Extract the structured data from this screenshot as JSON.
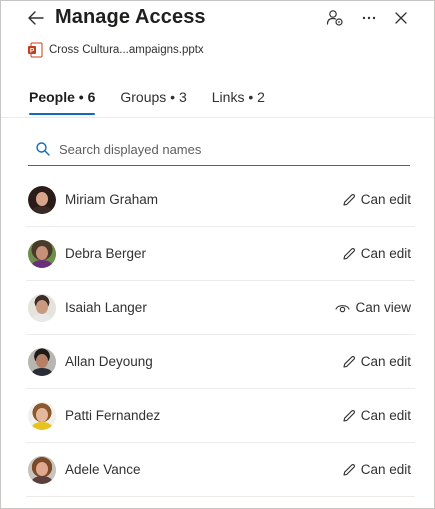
{
  "header": {
    "title": "Manage Access",
    "back_icon": "arrow-left-icon",
    "manage_icon": "people-settings-icon",
    "more_icon": "more-horizontal-icon",
    "close_icon": "close-icon"
  },
  "file": {
    "name": "Cross Cultura...ampaigns.pptx",
    "icon": "powerpoint-file-icon",
    "icon_color": "#c43e1c"
  },
  "tabs": [
    {
      "label": "People • 6",
      "active": true
    },
    {
      "label": "Groups • 3",
      "active": false
    },
    {
      "label": "Links • 2",
      "active": false
    }
  ],
  "search": {
    "placeholder": "Search displayed names",
    "value": ""
  },
  "people": [
    {
      "name": "Miriam Graham",
      "permission": "Can edit",
      "perm_icon": "pencil-icon"
    },
    {
      "name": "Debra Berger",
      "permission": "Can edit",
      "perm_icon": "pencil-icon"
    },
    {
      "name": "Isaiah Langer",
      "permission": "Can view",
      "perm_icon": "eye-icon"
    },
    {
      "name": "Allan Deyoung",
      "permission": "Can edit",
      "perm_icon": "pencil-icon"
    },
    {
      "name": "Patti Fernandez",
      "permission": "Can edit",
      "perm_icon": "pencil-icon"
    },
    {
      "name": "Adele Vance",
      "permission": "Can edit",
      "perm_icon": "pencil-icon"
    }
  ],
  "colors": {
    "accent": "#0f6cbd",
    "text": "#323130",
    "divider": "#edebe9"
  }
}
